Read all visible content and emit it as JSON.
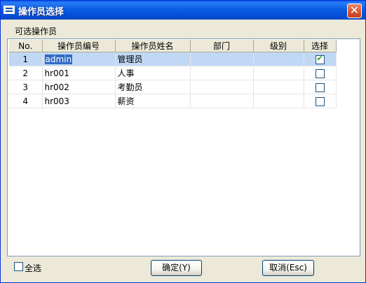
{
  "window": {
    "title": "操作员选择",
    "close_glyph": "✕"
  },
  "group_label": "可选操作员",
  "table": {
    "headers": [
      "No.",
      "操作员编号",
      "操作员姓名",
      "部门",
      "级别",
      "选择"
    ],
    "rows": [
      {
        "no": "1",
        "id": "admin",
        "name": "管理员",
        "dept": "",
        "level": "",
        "selected": true
      },
      {
        "no": "2",
        "id": "hr001",
        "name": "人事",
        "dept": "",
        "level": "",
        "selected": false
      },
      {
        "no": "3",
        "id": "hr002",
        "name": "考勤员",
        "dept": "",
        "level": "",
        "selected": false
      },
      {
        "no": "4",
        "id": "hr003",
        "name": "薪资",
        "dept": "",
        "level": "",
        "selected": false
      }
    ]
  },
  "footer": {
    "select_all_label": "全选",
    "select_all_checked": false,
    "ok_label": "确定(Y)",
    "cancel_label": "取消(Esc)"
  },
  "colors": {
    "titlebar": "#0b5ce4",
    "dialog_bg": "#ece9d8",
    "selected_row": "#c0d8f4",
    "highlight": "#316ac5"
  }
}
